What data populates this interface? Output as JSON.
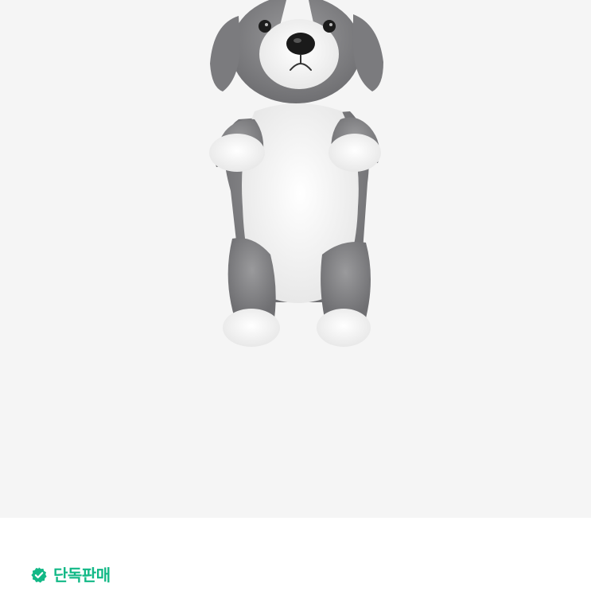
{
  "product": {
    "image_subject": "plush-beagle-toy",
    "background_color": "#f5f5f5"
  },
  "badge": {
    "label": "단독판매",
    "icon": "verified-check-icon",
    "color": "#12b886"
  }
}
